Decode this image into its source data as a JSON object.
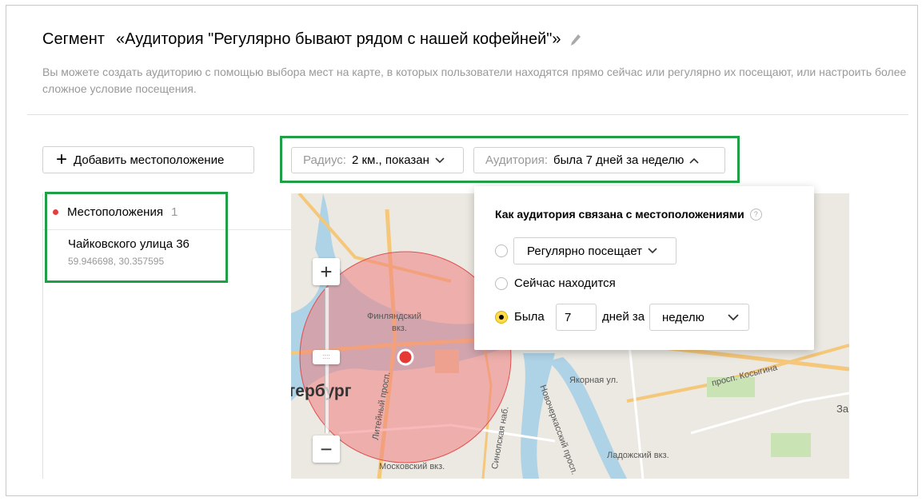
{
  "header": {
    "segment_label": "Сегмент",
    "title": "«Аудитория \"Регулярно бывают рядом с нашей кофейней\"»",
    "description": "Вы можете создать аудиторию с помощью выбора мест на карте, в которых пользователи находятся прямо сейчас или регулярно их посещают, или настроить более сложное условие посещения.",
    "edit_icon": "pencil-icon"
  },
  "toolbar": {
    "add_location_label": "Добавить местоположение",
    "radius_label": "Радиус:",
    "radius_value": "2 км., показан",
    "audience_label": "Аудитория:",
    "audience_value": "была 7 дней за неделю"
  },
  "locations": {
    "header": "Местоположения",
    "count": "1",
    "items": [
      {
        "name": "Чайковского улица 36",
        "coords": "59.946698, 30.357595"
      }
    ]
  },
  "map": {
    "city_label": "тербург",
    "labels": {
      "finland_station": "Финляндский",
      "finland_station_2": "вкз.",
      "moscow_station": "Московский вкз.",
      "ladoga_station": "Ладожский вкз.",
      "yakornaya": "Якорная ул.",
      "kosygina": "просп. Косыгина",
      "liteyny": "Литейный просп.",
      "sinopskaya": "Синопская наб.",
      "novocherkassky": "Новочеркасский просп.",
      "side_label": "За"
    },
    "zoom_in": "+",
    "zoom_out": "−",
    "zoom_handle": "::::"
  },
  "audience_popup": {
    "title": "Как аудитория связана с местоположениями",
    "help": "?",
    "options": {
      "regular_select": "Регулярно посещает",
      "now": "Сейчас находится",
      "was": "Была",
      "days_value": "7",
      "days_for": "дней за",
      "period_select": "неделю"
    },
    "selected_option": "was"
  },
  "colors": {
    "highlight_green": "#1fa046",
    "radius_circle": "#f08080",
    "location_dot": "#e04040",
    "radio_selected": "#ffdb4d"
  }
}
